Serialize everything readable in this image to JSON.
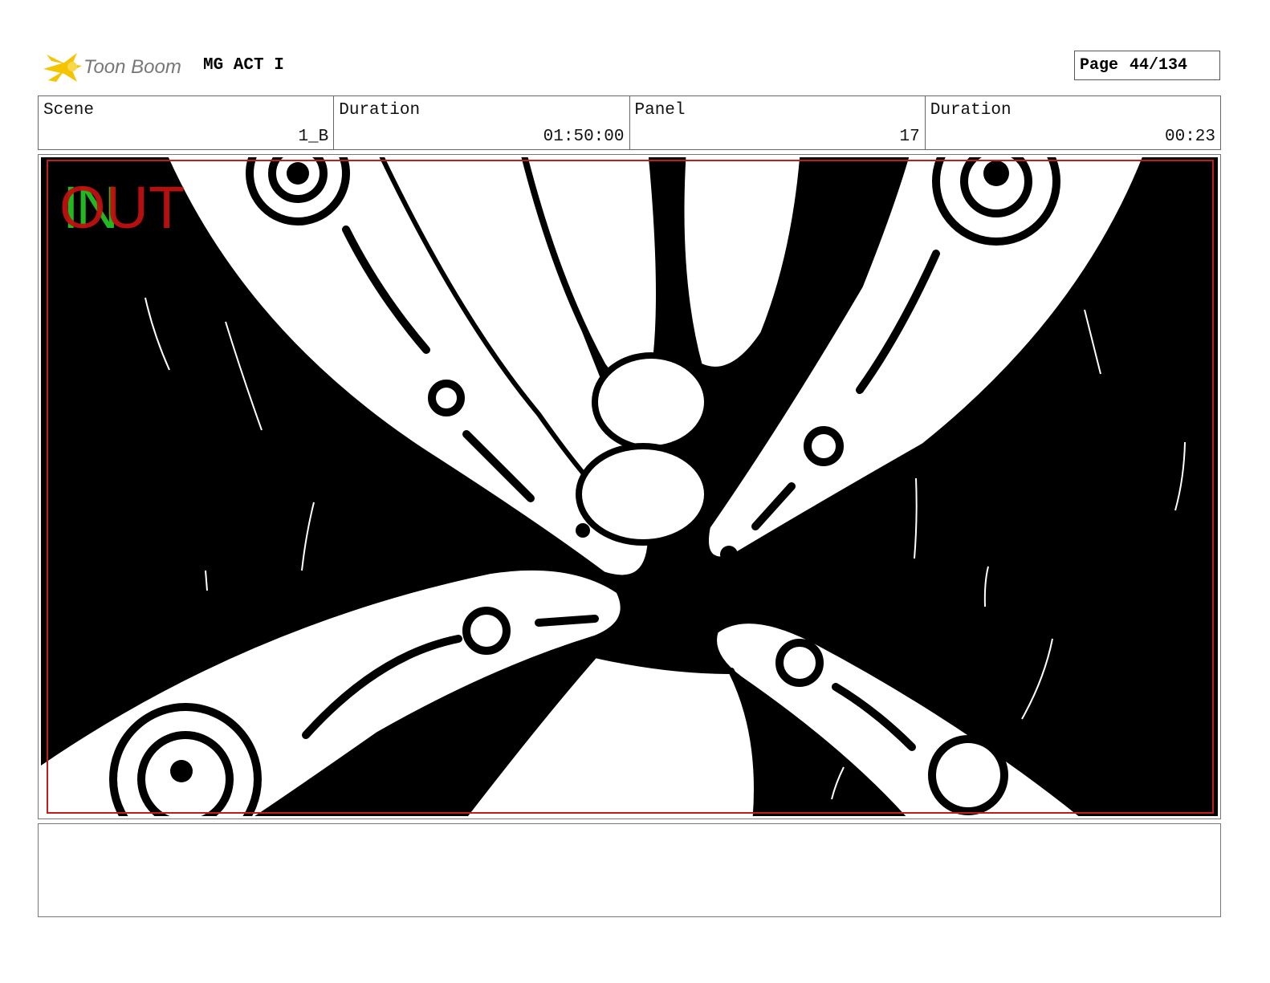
{
  "header": {
    "logo_text": "Toon Boom",
    "project_title": "MG ACT I",
    "page_label": "Page",
    "page_value": "44/134"
  },
  "info": {
    "scene_label": "Scene",
    "scene_value": "1_B",
    "scene_duration_label": "Duration",
    "scene_duration_value": "01:50:00",
    "panel_label": "Panel",
    "panel_value": "17",
    "panel_duration_label": "Duration",
    "panel_duration_value": "00:23"
  },
  "panel": {
    "in_marker": "IN",
    "out_marker": "OUT"
  },
  "notes": {
    "text": ""
  },
  "colors": {
    "safe_frame": "#c21d1d",
    "in_marker": "#22b822",
    "out_marker": "#c01010",
    "logo_yellow": "#f5c400"
  }
}
